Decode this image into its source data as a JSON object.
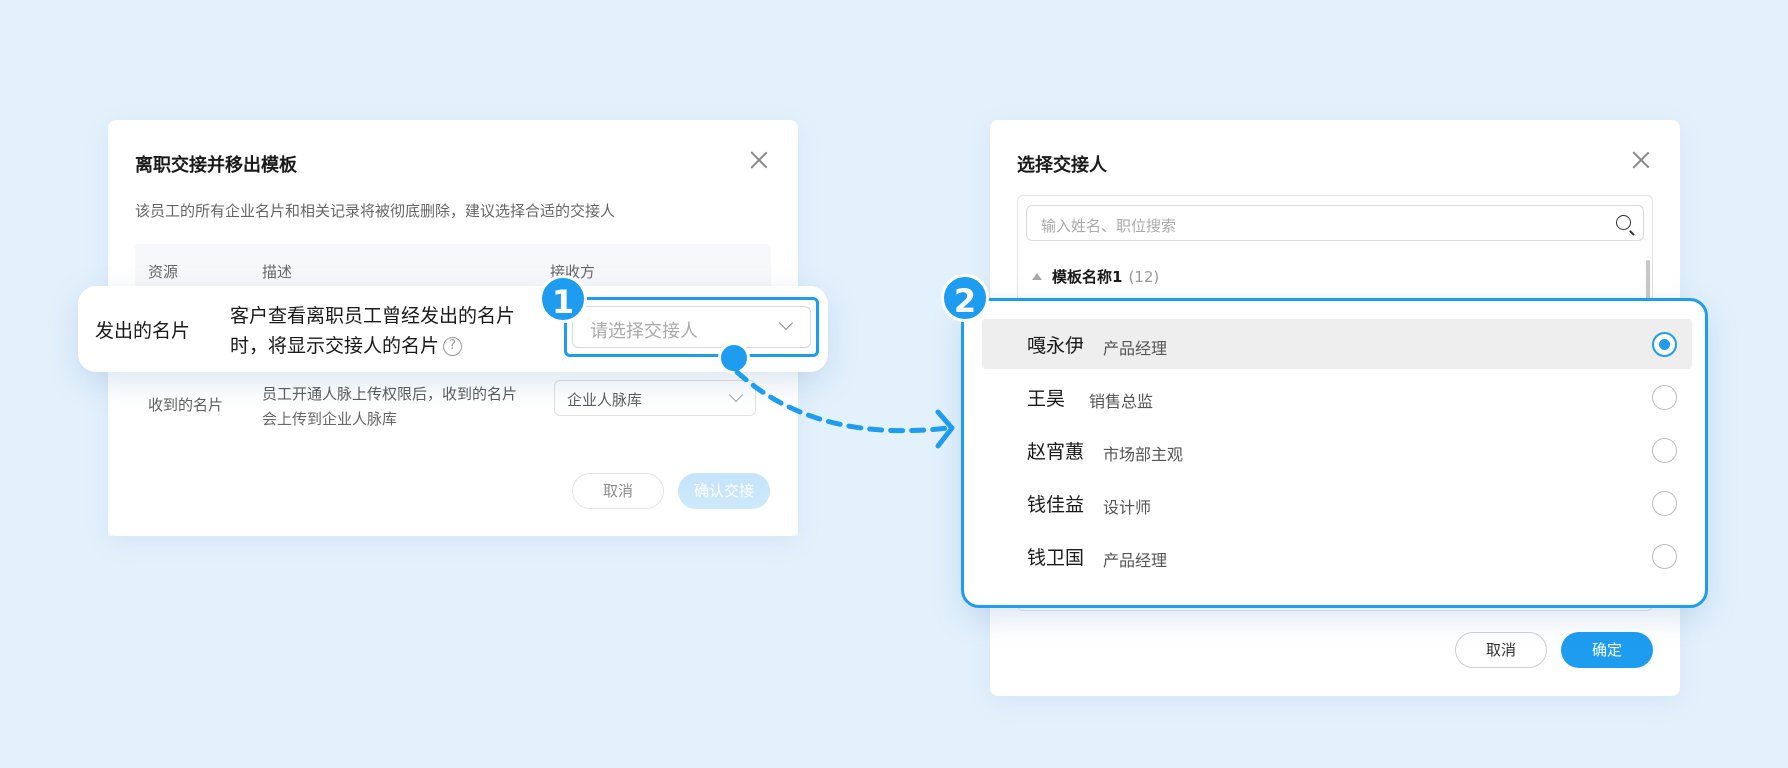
{
  "colors": {
    "accent": "#1d9cf0",
    "background": "#e3f1fc"
  },
  "handover_modal": {
    "title": "离职交接并移出模板",
    "subtitle": "该员工的所有企业名片和相关记录将被彻底删除，建议选择合适的交接人",
    "columns": [
      "资源",
      "描述",
      "接收方"
    ],
    "rows": [
      {
        "resource": "发出的名片",
        "description": "客户查看离职员工曾经发出的名片时，将显示交接人的名片",
        "receiver_placeholder": "请选择交接人"
      },
      {
        "resource": "收到的名片",
        "description": "员工开通人脉上传权限后，收到的名片会上传到企业人脉库",
        "receiver_value": "企业人脉库"
      }
    ],
    "help_icon": "?",
    "cancel_label": "取消",
    "confirm_label": "确认交接"
  },
  "step_badges": [
    "1",
    "2"
  ],
  "picker_modal": {
    "title": "选择交接人",
    "search_placeholder": "输入姓名、职位搜索",
    "group_name": "模板名称1",
    "group_count": "(12)",
    "people": [
      {
        "name": "嘎永伊",
        "role": "产品经理",
        "selected": true
      },
      {
        "name": "王昊",
        "role": "销售总监",
        "selected": false
      },
      {
        "name": "赵宵蕙",
        "role": "市场部主观",
        "selected": false
      },
      {
        "name": "钱佳益",
        "role": "设计师",
        "selected": false
      },
      {
        "name": "钱卫国",
        "role": "产品经理",
        "selected": false
      }
    ],
    "cancel_label": "取消",
    "ok_label": "确定"
  }
}
